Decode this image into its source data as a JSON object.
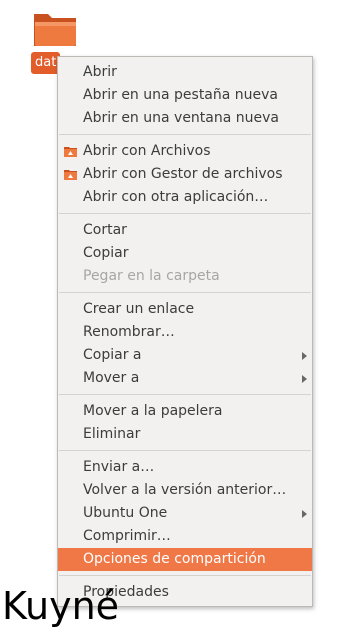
{
  "desktop": {
    "folder_label": "dat",
    "folder_icon": "folder-icon"
  },
  "menu": {
    "abrir": "Abrir",
    "abrir_pestana": "Abrir en una pestaña nueva",
    "abrir_ventana": "Abrir en una ventana nueva",
    "abrir_archivos": "Abrir con Archivos",
    "abrir_gestor": "Abrir con Gestor de archivos",
    "abrir_otra": "Abrir con otra aplicación…",
    "cortar": "Cortar",
    "copiar": "Copiar",
    "pegar": "Pegar en la carpeta",
    "crear_enlace": "Crear un enlace",
    "renombrar": "Renombrar…",
    "copiar_a": "Copiar a",
    "mover_a": "Mover a",
    "mover_papelera": "Mover a la papelera",
    "eliminar": "Eliminar",
    "enviar_a": "Enviar a…",
    "volver_version": "Volver a la versión anterior…",
    "ubuntu_one": "Ubuntu One",
    "comprimir": "Comprimir…",
    "opciones_comparticion": "Opciones de compartición",
    "propiedades": "Propiedades"
  },
  "watermark": "Kuyné",
  "colors": {
    "highlight": "#f07746",
    "folder": "#e8632c",
    "label_bg": "#e25d2a"
  }
}
